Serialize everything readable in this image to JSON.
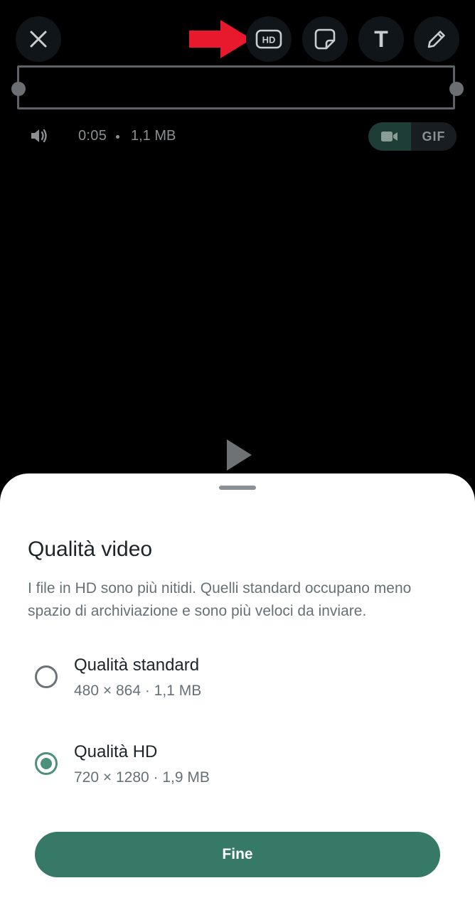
{
  "toolbar": {
    "close_icon": "close-icon",
    "hd_label": "HD",
    "sticker_icon": "sticker-icon",
    "text_label": "T",
    "pencil_icon": "pencil-icon",
    "arrow_color": "#e8192c"
  },
  "video_info": {
    "duration": "0:05",
    "size": "1,1 MB",
    "gif_label": "GIF"
  },
  "sheet": {
    "title": "Qualità video",
    "description": "I file in HD sono più nitidi. Quelli standard occupano meno spazio di archiviazione e sono più veloci da inviare.",
    "options": [
      {
        "label": "Qualità standard",
        "detail": "480 × 864 · 1,1 MB",
        "selected": false
      },
      {
        "label": "Qualità HD",
        "detail": "720 × 1280 · 1,9 MB",
        "selected": true
      }
    ],
    "done_label": "Fine"
  },
  "colors": {
    "accent": "#357966",
    "radio_checked": "#4d8f7c"
  }
}
